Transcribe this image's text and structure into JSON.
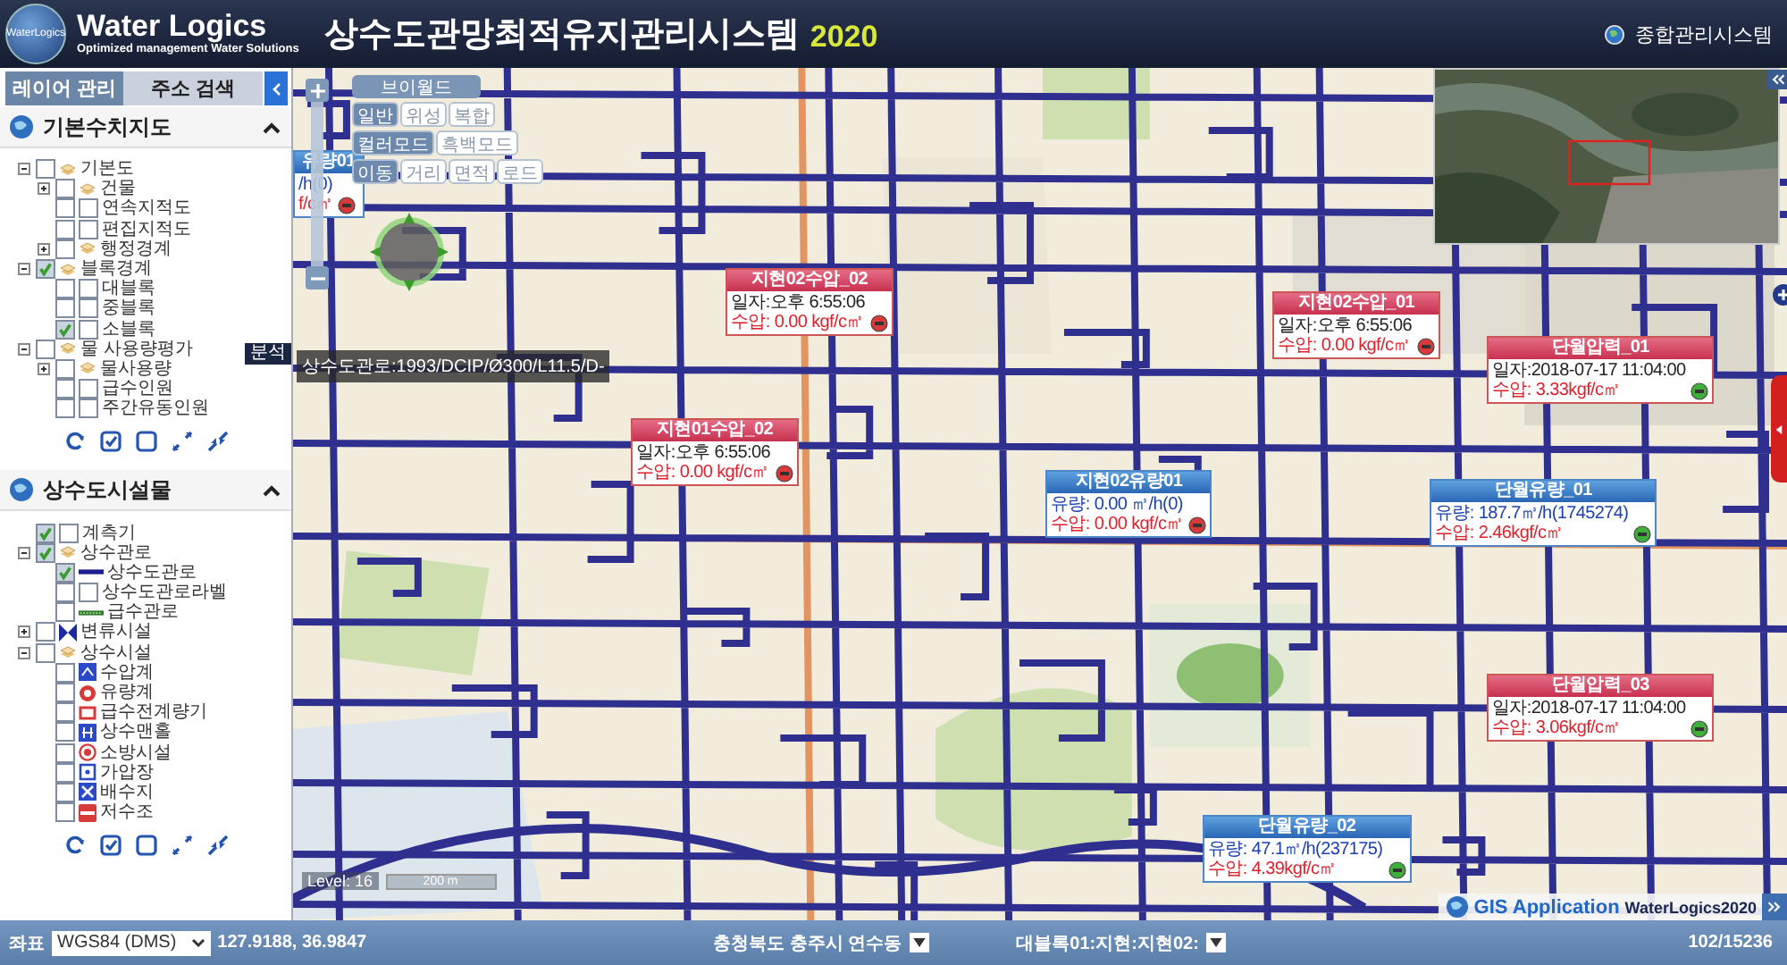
{
  "header": {
    "logo_badge": "WaterLogics",
    "brand": "Water Logics",
    "tagline": "Optimized management Water Solutions",
    "title": "상수도관망최적유지관리시스템",
    "year": "2020",
    "system_link": "종합관리시스템"
  },
  "left_panel": {
    "tabs": [
      {
        "label": "레이어 관리",
        "selected": true
      },
      {
        "label": "주소 검색",
        "selected": false
      }
    ],
    "analysis_badge": "분석",
    "sections": [
      {
        "title": "기본수치지도",
        "expanded": true,
        "tree": [
          {
            "label": "기본도",
            "checked": false,
            "expanded": true,
            "kind": "layer",
            "children": [
              {
                "label": "건물",
                "checked": false,
                "expanded": false,
                "kind": "layer"
              },
              {
                "label": "연속지적도",
                "checked": false,
                "kind": "checkbox",
                "sub_checked": false
              },
              {
                "label": "편집지적도",
                "checked": false,
                "kind": "checkbox",
                "sub_checked": false
              },
              {
                "label": "행정경계",
                "checked": false,
                "expanded": false,
                "kind": "layer"
              }
            ]
          },
          {
            "label": "블록경계",
            "checked": true,
            "expanded": true,
            "kind": "layer",
            "children": [
              {
                "label": "대블록",
                "checked": false,
                "kind": "checkbox",
                "sub_checked": false
              },
              {
                "label": "중블록",
                "checked": false,
                "kind": "checkbox",
                "sub_checked": false
              },
              {
                "label": "소블록",
                "checked": true,
                "kind": "checkbox",
                "sub_checked": false
              }
            ]
          },
          {
            "label": "물 사용량평가",
            "checked": false,
            "expanded": true,
            "kind": "layer",
            "children": [
              {
                "label": "물사용량",
                "checked": false,
                "expanded": false,
                "kind": "layer"
              },
              {
                "label": "급수인원",
                "checked": false,
                "kind": "checkbox",
                "sub_checked": false
              },
              {
                "label": "주간유동인원",
                "checked": false,
                "kind": "checkbox",
                "sub_checked": false
              }
            ]
          }
        ]
      },
      {
        "title": "상수도시설물",
        "expanded": true,
        "tree": [
          {
            "label": "계측기",
            "checked": true,
            "kind": "checkbox",
            "sub_checked": false
          },
          {
            "label": "상수관로",
            "checked": true,
            "expanded": true,
            "kind": "layer",
            "children": [
              {
                "label": "상수도관로",
                "checked": true,
                "kind": "pipe"
              },
              {
                "label": "상수도관로라벨",
                "checked": false,
                "kind": "checkbox",
                "sub_checked": false
              },
              {
                "label": "급수관로",
                "checked": false,
                "kind": "service"
              }
            ]
          },
          {
            "label": "변류시설",
            "checked": false,
            "expanded": false,
            "kind": "valve"
          },
          {
            "label": "상수시설",
            "checked": false,
            "expanded": true,
            "kind": "layer",
            "children": [
              {
                "label": "수압계",
                "checked": false,
                "kind": "gauge"
              },
              {
                "label": "유량계",
                "checked": false,
                "kind": "flowmeter"
              },
              {
                "label": "급수전계량기",
                "checked": false,
                "kind": "meter"
              },
              {
                "label": "상수맨홀",
                "checked": false,
                "kind": "manhole"
              },
              {
                "label": "소방시설",
                "checked": false,
                "kind": "hydrant"
              },
              {
                "label": "가압장",
                "checked": false,
                "kind": "pump"
              },
              {
                "label": "배수지",
                "checked": false,
                "kind": "reservoir"
              },
              {
                "label": "저수조",
                "checked": false,
                "kind": "tank"
              }
            ]
          }
        ]
      }
    ]
  },
  "map": {
    "basemap": {
      "title": "브이월드",
      "modes": [
        {
          "label": "일반",
          "selected": true
        },
        {
          "label": "위성",
          "selected": false
        },
        {
          "label": "복합",
          "selected": false
        }
      ],
      "color_modes": [
        {
          "label": "컬러모드",
          "selected": true
        },
        {
          "label": "흑백모드",
          "selected": false
        }
      ],
      "tools": [
        {
          "label": "이동",
          "selected": true
        },
        {
          "label": "거리",
          "selected": false
        },
        {
          "label": "면적",
          "selected": false
        },
        {
          "label": "로드",
          "selected": false
        }
      ]
    },
    "tooltip": "상수도관로:1993/DCIP/Ø300/L11.5/D-",
    "sensors": [
      {
        "kind": "flow",
        "title": "유량01",
        "lines": [
          "/h(0)",
          "f/c㎡"
        ],
        "alarm": true
      },
      {
        "kind": "pressure",
        "title": "지현02수압_02",
        "lines": [
          "일자:오후 6:55:06",
          "수압: 0.00 kgf/c㎡"
        ],
        "alarm": true
      },
      {
        "kind": "pressure",
        "title": "지현02수압_01",
        "lines": [
          "일자:오후 6:55:06",
          "수압: 0.00 kgf/c㎡"
        ],
        "alarm": true
      },
      {
        "kind": "pressure",
        "title": "단월압력_01",
        "lines": [
          "일자:2018-07-17 11:04:00",
          "수압: 3.33kgf/c㎡"
        ],
        "alarm": false
      },
      {
        "kind": "pressure",
        "title": "지현01수압_02",
        "lines": [
          "일자:오후 6:55:06",
          "수압: 0.00 kgf/c㎡"
        ],
        "alarm": true
      },
      {
        "kind": "flow",
        "title": "지현02유량01",
        "lines": [
          "유량: 0.00 ㎥/h(0)",
          "수압: 0.00 kgf/c㎡"
        ],
        "alarm": true
      },
      {
        "kind": "flow",
        "title": "단월유량_01",
        "lines": [
          "유량: 187.7㎥/h(1745274)",
          "수압: 2.46kgf/c㎡"
        ],
        "alarm": false
      },
      {
        "kind": "pressure",
        "title": "단월압력_03",
        "lines": [
          "일자:2018-07-17 11:04:00",
          "수압: 3.06kgf/c㎡"
        ],
        "alarm": false
      },
      {
        "kind": "flow",
        "title": "단월유량_02",
        "lines": [
          "유량: 47.1㎥/h(237175)",
          "수압: 4.39kgf/c㎡"
        ],
        "alarm": false
      }
    ],
    "level_label": "Level: 16",
    "scale": "200 m",
    "footer_badge": {
      "title": "GIS Application",
      "product": "WaterLogics2020"
    }
  },
  "status_bar": {
    "coord_label": "좌표",
    "crs": "WGS84 (DMS)",
    "coordinates": "127.9188, 36.9847",
    "address": "충청북도 충주시 연수동",
    "block": "대블록01:지현:지현02:",
    "count": "102/15236"
  }
}
